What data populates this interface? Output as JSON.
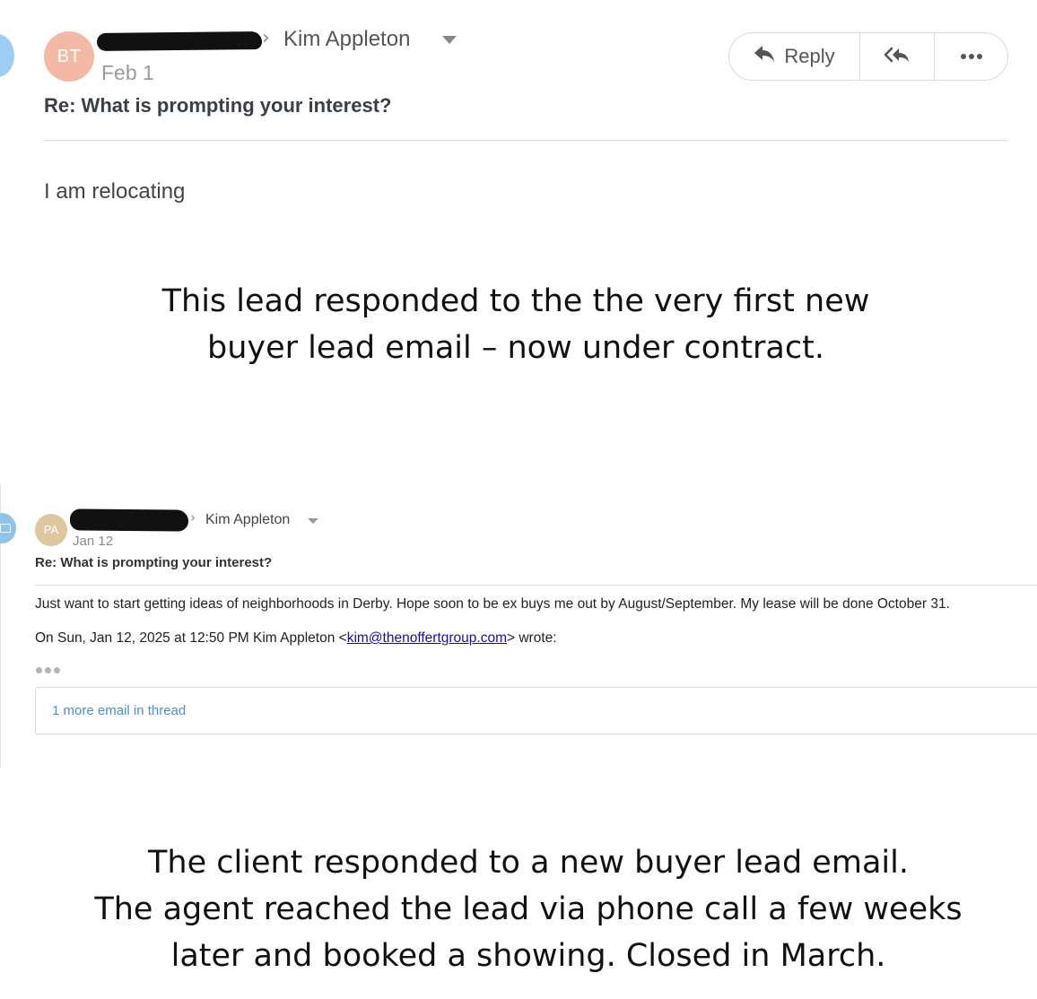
{
  "email1": {
    "avatar_initials": "BT",
    "recipient": "Kim Appleton",
    "date": "Feb 1",
    "subject": "Re: What is prompting your interest?",
    "body": "I am relocating",
    "actions": {
      "reply_label": "Reply",
      "reply_icon": "reply-arrow-icon",
      "reply_all_icon": "reply-all-arrows-icon",
      "more_icon": "ellipsis-icon"
    }
  },
  "caption1": {
    "line1": "This lead responded to the the very first new",
    "line2": "buyer lead email – now under contract."
  },
  "email2": {
    "avatar_initials": "PA",
    "recipient": "Kim Appleton",
    "date": "Jan 12",
    "subject": "Re: What is prompting your interest?",
    "body": "Just want to start getting ideas of neighborhoods in Derby. Hope soon to be ex buys me out by August/September. My lease will be done October 31.",
    "quote_prefix": "On Sun, Jan 12, 2025 at 12:50 PM Kim Appleton <",
    "quote_email": "kim@thenoffertgroup.com",
    "quote_suffix": "> wrote:",
    "thread_link": "1 more email in thread"
  },
  "caption2": {
    "line1": "The client responded to a new buyer lead email.",
    "line2": "The agent reached the lead via phone call a few weeks",
    "line3": "later and booked a showing. Closed in March."
  },
  "colors": {
    "avatar_bt": "#f4b9a4",
    "avatar_pa": "#ddc79f",
    "side_marker": "#9ccdf2",
    "link_blue": "#1a0dab",
    "thread_link": "#4a90c9"
  }
}
